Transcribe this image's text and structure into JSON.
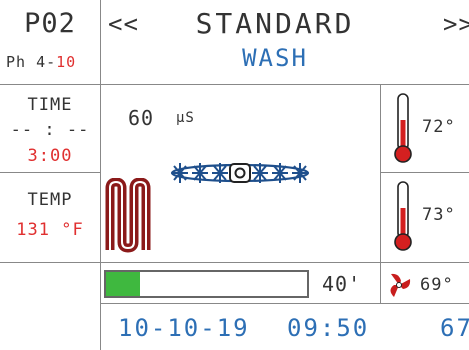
{
  "program": {
    "code": "P02",
    "ph_label": "Ph",
    "ph_value": "4-",
    "ph_red": "10"
  },
  "nav": {
    "prev": "<<",
    "next": ">>"
  },
  "cycle": {
    "title": "STANDARD",
    "subtitle": "WASH"
  },
  "time": {
    "label": "TIME",
    "elapsed": "-- : --",
    "total": "3:00"
  },
  "temp": {
    "label": "TEMP",
    "value": "131 °F"
  },
  "conductivity": {
    "value": "60",
    "unit": "μS"
  },
  "tank_temps": [
    {
      "value": "72°"
    },
    {
      "value": "73°"
    }
  ],
  "fan_temp": {
    "value": "69°"
  },
  "progress": {
    "fraction": 0.17,
    "remaining": "40'"
  },
  "footer": {
    "date": "10-10-19",
    "time": "09:50",
    "extra": "67"
  },
  "colors": {
    "red": "#e03030",
    "blue": "#2d6fb5",
    "green": "#3fb83f",
    "heater": "#8b1a1a"
  }
}
